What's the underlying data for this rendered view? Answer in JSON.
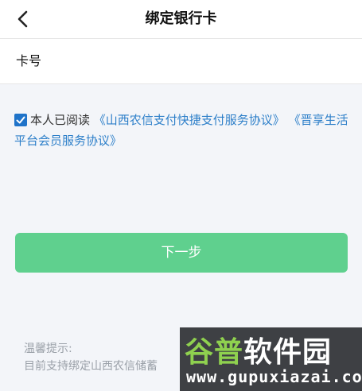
{
  "header": {
    "title": "绑定银行卡",
    "back_icon": "chevron-left-icon"
  },
  "card": {
    "label": "卡号",
    "value": "",
    "placeholder": ""
  },
  "agreement": {
    "checked": true,
    "prefix": "本人已阅读",
    "link1": "《山西农信支付快捷支付服务协议》",
    "link2": "《晋享生活平台会员服务协议》"
  },
  "next_button": {
    "label": "下一步"
  },
  "tips": {
    "title": "温馨提示:",
    "text": "目前支持绑定山西农信储蓄"
  },
  "watermark": {
    "brand_part1": "谷普",
    "brand_part2": "软件园",
    "url": "www.gupuxiazai.com"
  },
  "colors": {
    "background": "#f3f5f9",
    "link": "#2d7fc9",
    "checkbox": "#1f73c9",
    "button": "#5fd08e"
  }
}
